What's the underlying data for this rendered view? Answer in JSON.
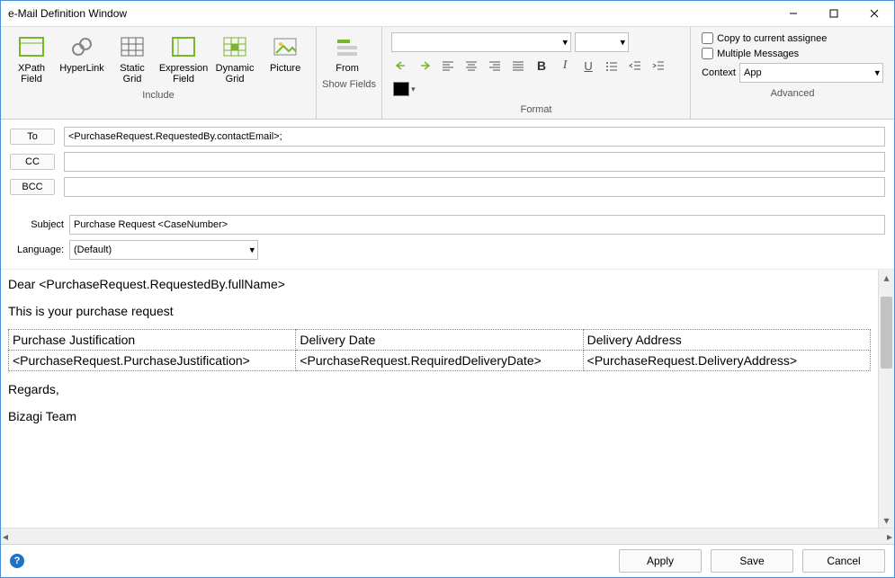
{
  "window": {
    "title": "e-Mail Definition Window"
  },
  "ribbon": {
    "include": {
      "label": "Include",
      "items": [
        {
          "label": "XPath\nField"
        },
        {
          "label": "HyperLink"
        },
        {
          "label": "Static\nGrid"
        },
        {
          "label": "Expression\nField"
        },
        {
          "label": "Dynamic\nGrid"
        },
        {
          "label": "Picture"
        }
      ]
    },
    "showfields": {
      "label": "Show Fields",
      "from": "From"
    },
    "format": {
      "label": "Format",
      "font_family": "",
      "font_size": ""
    },
    "advanced": {
      "label": "Advanced",
      "copy_assignee": "Copy to current assignee",
      "multiple_messages": "Multiple Messages",
      "context_label": "Context",
      "context_value": "App"
    }
  },
  "fields": {
    "to_label": "To",
    "cc_label": "CC",
    "bcc_label": "BCC",
    "subject_label": "Subject",
    "language_label": "Language:",
    "to_value": "<PurchaseRequest.RequestedBy.contactEmail>;",
    "cc_value": "",
    "bcc_value": "",
    "subject_value": "Purchase Request <CaseNumber>",
    "language_value": "(Default)"
  },
  "body": {
    "line1": "Dear <PurchaseRequest.RequestedBy.fullName>",
    "line2": "This is your purchase request",
    "table": {
      "headers": [
        "Purchase Justification",
        "Delivery Date",
        "Delivery Address"
      ],
      "row": [
        "<PurchaseRequest.PurchaseJustification>",
        "<PurchaseRequest.RequiredDeliveryDate>",
        "<PurchaseRequest.DeliveryAddress>"
      ]
    },
    "line3": "Regards,",
    "line4": "Bizagi Team"
  },
  "footer": {
    "apply": "Apply",
    "save": "Save",
    "cancel": "Cancel"
  }
}
